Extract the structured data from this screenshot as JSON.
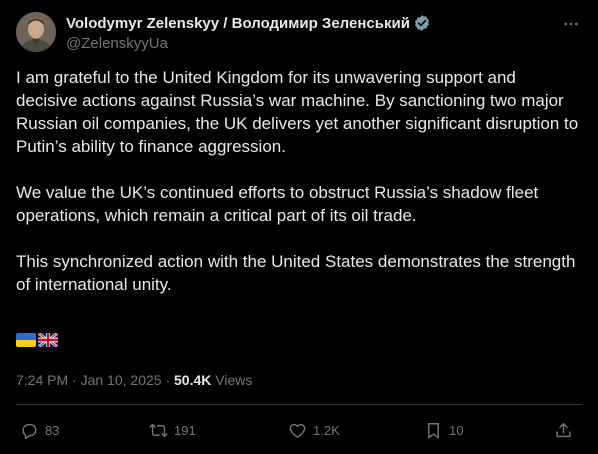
{
  "author": {
    "display_name": "Volodymyr Zelenskyy / Володимир Зеленський",
    "handle": "@ZelenskyyUa",
    "verified": true,
    "avatar_icon": "avatar-photo"
  },
  "tweet": {
    "paragraphs": [
      "I am grateful to the United Kingdom for its unwavering support and decisive actions against Russia’s war machine. By sanctioning two major Russian oil companies, the UK delivers yet another significant disruption to Putin’s ability to finance aggression.",
      "We value the UK’s continued efforts to obstruct Russia’s shadow fleet operations, which remain a critical part of its oil trade.",
      "This synchronized action with the United States demonstrates the strength of international unity."
    ],
    "flags": [
      "ukraine-flag",
      "united-kingdom-flag"
    ]
  },
  "meta": {
    "time": "7:24 PM",
    "date": "Jan 10, 2025",
    "separator": "·",
    "views_count": "50.4K",
    "views_label": "Views"
  },
  "actions": {
    "replies": "83",
    "reposts": "191",
    "likes": "1.2K",
    "bookmarks": "10"
  },
  "colors": {
    "background": "#000000",
    "text": "#e7e9ea",
    "secondary": "#71767b",
    "divider": "#2f3336",
    "verified_badge": "#829aab"
  }
}
